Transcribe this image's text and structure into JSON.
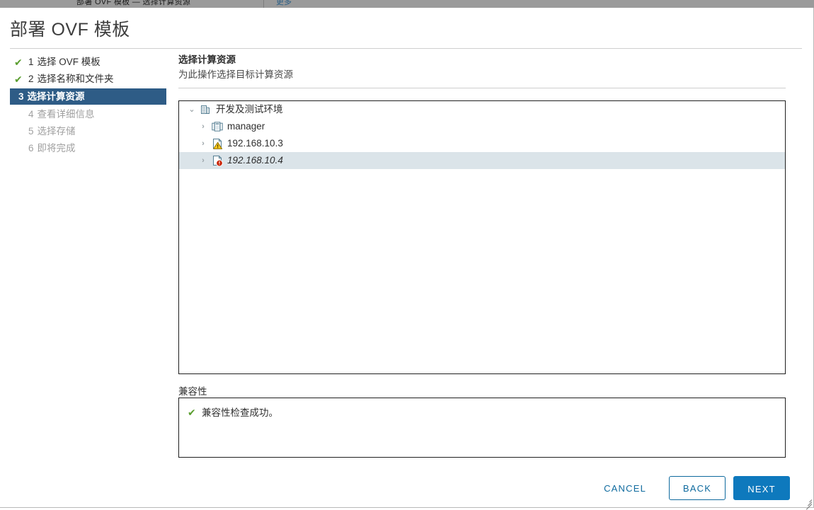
{
  "app_chrome": {
    "breadcrumb": "部署 OVF 模板 — 选择计算资源",
    "link": "更多"
  },
  "dialog": {
    "title": "部署 OVF 模板"
  },
  "steps": [
    {
      "num": "1",
      "label": "选择 OVF 模板",
      "state": "done",
      "tick": "✔"
    },
    {
      "num": "2",
      "label": "选择名称和文件夹",
      "state": "done",
      "tick": "✔"
    },
    {
      "num": "3",
      "label": "选择计算资源",
      "state": "current",
      "tick": ""
    },
    {
      "num": "4",
      "label": "查看详细信息",
      "state": "upcoming",
      "tick": ""
    },
    {
      "num": "5",
      "label": "选择存储",
      "state": "upcoming",
      "tick": ""
    },
    {
      "num": "6",
      "label": "即将完成",
      "state": "upcoming",
      "tick": ""
    }
  ],
  "content": {
    "heading": "选择计算资源",
    "subheading": "为此操作选择目标计算资源"
  },
  "tree": {
    "nodes": [
      {
        "label": "开发及测试环境",
        "depth": 0,
        "icon": "datacenter-icon",
        "twisty": "expanded",
        "badge": "none",
        "selected": false
      },
      {
        "label": "manager",
        "depth": 1,
        "icon": "cluster-icon",
        "twisty": "collapsed",
        "badge": "none",
        "selected": false
      },
      {
        "label": "192.168.10.3",
        "depth": 1,
        "icon": "host-icon",
        "twisty": "collapsed",
        "badge": "warning",
        "selected": false
      },
      {
        "label": "192.168.10.4",
        "depth": 1,
        "icon": "host-icon",
        "twisty": "collapsed",
        "badge": "error",
        "selected": true
      }
    ],
    "twisty_glyphs": {
      "expanded": "⌄",
      "collapsed": "›"
    }
  },
  "compatibility": {
    "label": "兼容性",
    "status_icon": "check-icon",
    "message": "兼容性检查成功。"
  },
  "footer": {
    "cancel_label": "CANCEL",
    "back_label": "BACK",
    "next_label": "NEXT"
  },
  "colors": {
    "accent_blue": "#0e79bd",
    "link_blue": "#0e6a9e",
    "active_step_bg": "#2e5c86",
    "success_green": "#5a9e2f",
    "warning_yellow": "#f2c31a",
    "error_red": "#c92100",
    "selection_bg": "#dbe4e9",
    "icon_blue": "#567f93"
  }
}
